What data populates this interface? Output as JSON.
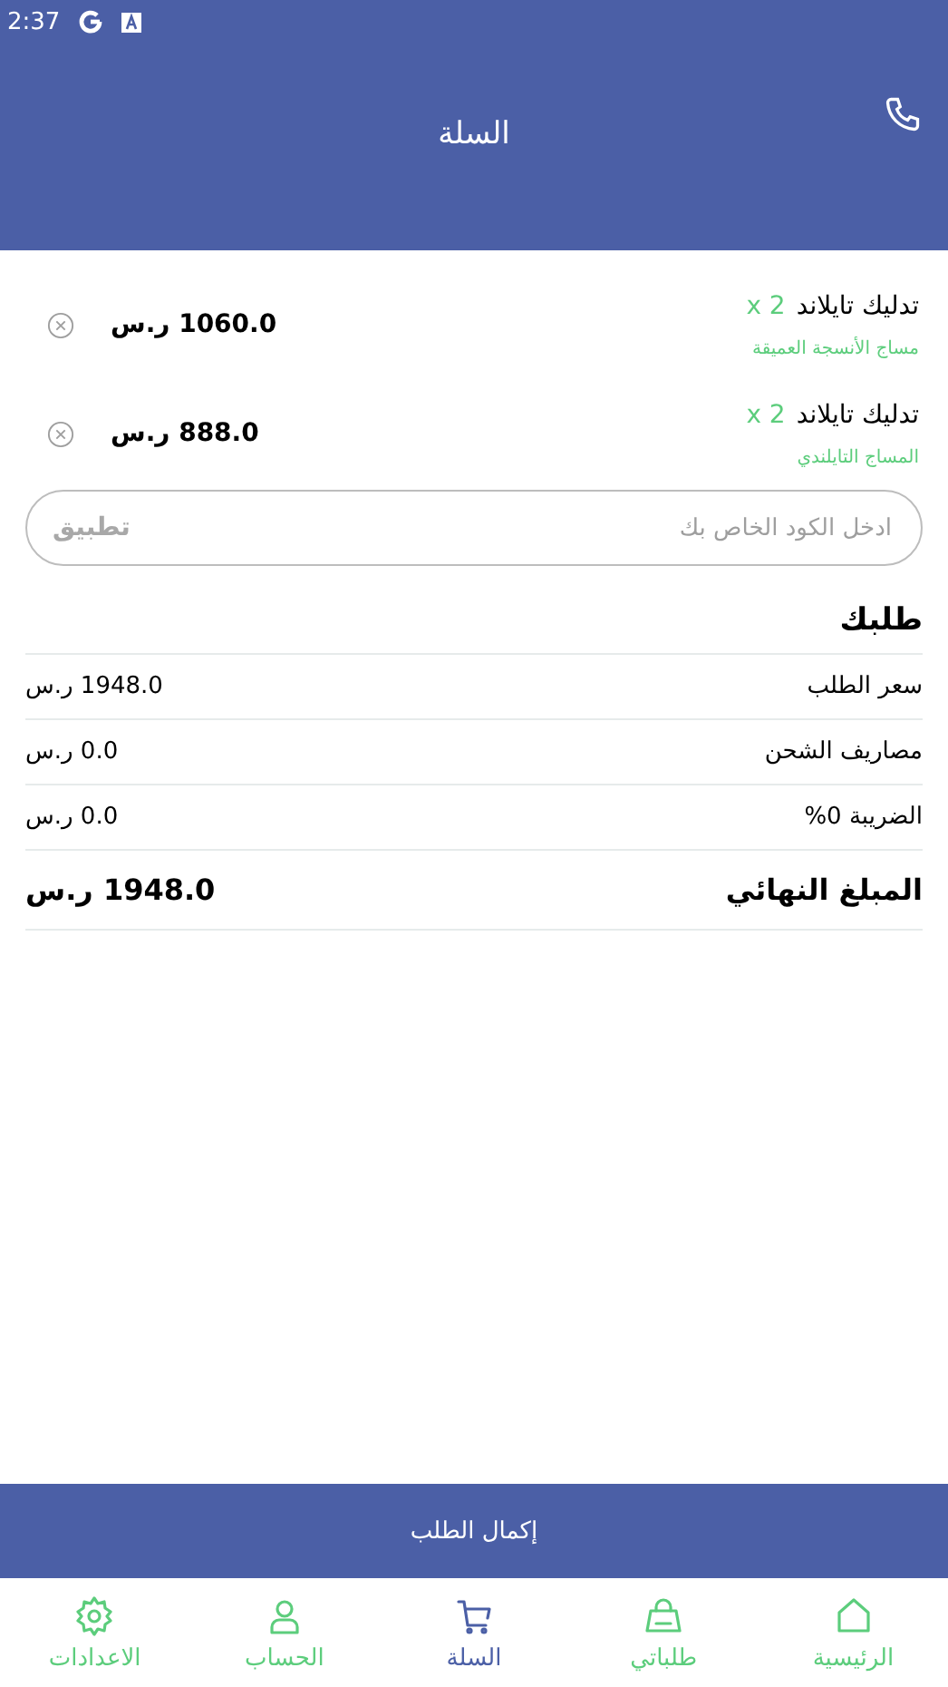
{
  "status_bar": {
    "time": "2:37"
  },
  "header": {
    "title": "السلة"
  },
  "cart_items": [
    {
      "name": "تدليك تايلاند",
      "quantity": "x 2",
      "subtitle": "مساج الأنسجة العميقة",
      "price": "1060.0 ر.س"
    },
    {
      "name": "تدليك تايلاند",
      "quantity": "x 2",
      "subtitle": "المساج التايلندي",
      "price": "888.0 ر.س"
    }
  ],
  "coupon": {
    "placeholder": "ادخل الكود الخاص بك",
    "apply": "تطبيق"
  },
  "summary": {
    "title": "طلبك",
    "rows": [
      {
        "label": "سعر الطلب",
        "value": "1948.0 ر.س"
      },
      {
        "label": "مصاريف الشحن",
        "value": "0.0 ر.س"
      },
      {
        "label": "الضريبة 0%",
        "value": "0.0 ر.س"
      }
    ],
    "total": {
      "label": "المبلغ النهائي",
      "value": "1948.0 ر.س"
    }
  },
  "checkout": "إكمال الطلب",
  "nav": [
    {
      "kind": "home",
      "label": "الرئيسية",
      "selected": false
    },
    {
      "kind": "bag",
      "label": "طلباتي",
      "selected": false
    },
    {
      "kind": "cart",
      "label": "السلة",
      "selected": true
    },
    {
      "kind": "user",
      "label": "الحساب",
      "selected": false
    },
    {
      "kind": "gear",
      "label": "الاعدادات",
      "selected": false
    }
  ]
}
